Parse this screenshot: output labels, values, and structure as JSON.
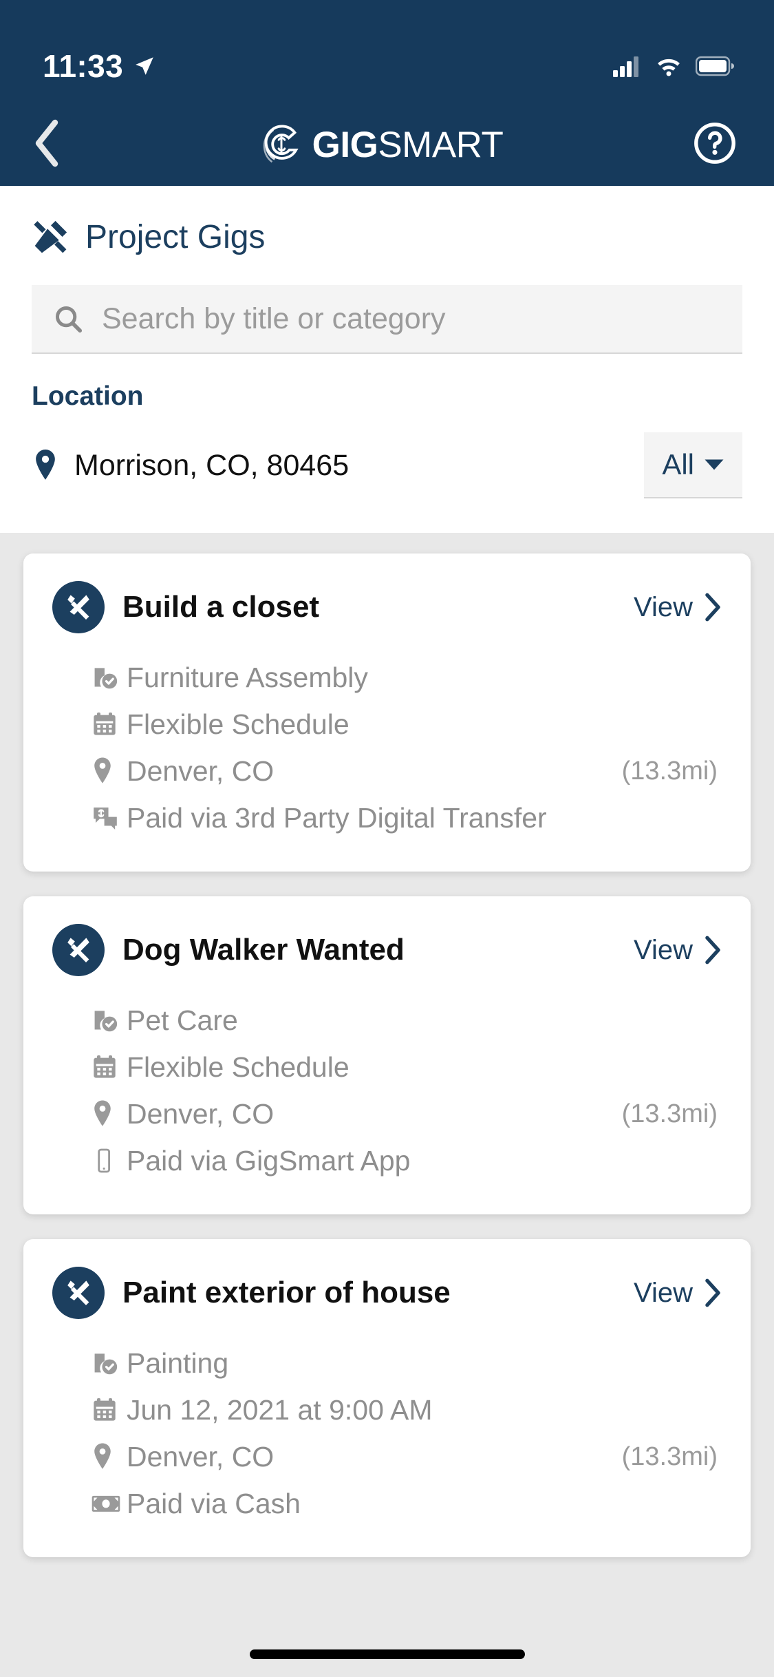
{
  "status_bar": {
    "time": "11:33",
    "location_arrow_icon": "location-arrow-icon",
    "cellular_icon": "cellular-signal-icon",
    "wifi_icon": "wifi-icon",
    "battery_icon": "battery-icon"
  },
  "nav": {
    "back_icon": "back-chevron-icon",
    "logo_mark_icon": "gigsmart-logo-mark-icon",
    "brand_bold": "GIG",
    "brand_light": "SMART",
    "help_icon": "help-circle-icon"
  },
  "header": {
    "title": "Project Gigs",
    "title_icon": "tools-icon"
  },
  "search": {
    "icon": "search-icon",
    "placeholder": "Search by title or category",
    "value": ""
  },
  "location": {
    "label": "Location",
    "pin_icon": "map-pin-icon",
    "value": "Morrison, CO, 80465",
    "filter_label": "All",
    "filter_caret_icon": "caret-down-icon"
  },
  "colors": {
    "brand_navy": "#163A5C",
    "accent_navy": "#1C3F5F",
    "page_bg": "#e8e8e8",
    "card_bg": "#ffffff",
    "muted_text": "#8e8e8e"
  },
  "gigs": [
    {
      "badge_icon": "tools-badge-icon",
      "title": "Build a closet",
      "view_label": "View",
      "view_chevron_icon": "chevron-right-icon",
      "category": "Furniture Assembly",
      "category_icon": "category-check-icon",
      "schedule": "Flexible Schedule",
      "schedule_icon": "calendar-icon",
      "place": "Denver, CO",
      "place_icon": "map-pin-icon",
      "distance": "(13.3mi)",
      "payment": "Paid via 3rd Party Digital Transfer",
      "payment_icon": "chat-dollar-icon"
    },
    {
      "badge_icon": "tools-badge-icon",
      "title": "Dog Walker Wanted",
      "view_label": "View",
      "view_chevron_icon": "chevron-right-icon",
      "category": "Pet Care",
      "category_icon": "category-check-icon",
      "schedule": "Flexible Schedule",
      "schedule_icon": "calendar-icon",
      "place": "Denver, CO",
      "place_icon": "map-pin-icon",
      "distance": "(13.3mi)",
      "payment": "Paid via GigSmart App",
      "payment_icon": "mobile-phone-icon"
    },
    {
      "badge_icon": "tools-badge-icon",
      "title": "Paint exterior of house",
      "view_label": "View",
      "view_chevron_icon": "chevron-right-icon",
      "category": "Painting",
      "category_icon": "category-check-icon",
      "schedule": "Jun 12, 2021 at 9:00 AM",
      "schedule_icon": "calendar-icon",
      "place": "Denver, CO",
      "place_icon": "map-pin-icon",
      "distance": "(13.3mi)",
      "payment": "Paid via Cash",
      "payment_icon": "cash-banknote-icon"
    }
  ]
}
